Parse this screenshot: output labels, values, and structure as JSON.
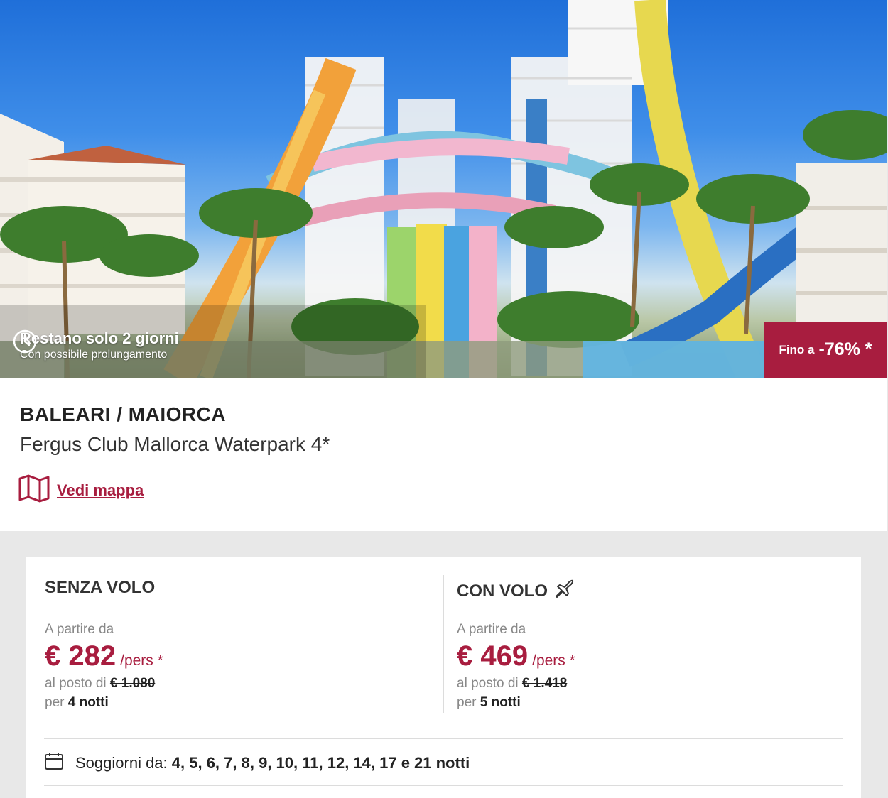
{
  "hero": {
    "timer_title": "Restano solo 2 giorni",
    "timer_subtitle": "Con possibile prolungamento",
    "discount_prefix": "Fino a",
    "discount_value": "-76% *",
    "image_subject": "waterpark slides"
  },
  "offer": {
    "region": "BALEARI / MAIORCA",
    "hotel_name": "Fergus Club Mallorca Waterpark 4*",
    "map_link": "Vedi mappa"
  },
  "pricing": {
    "without_flight": {
      "title": "SENZA VOLO",
      "from_label": "A partire da",
      "price": "€ 282",
      "per_label": "/pers *",
      "instead_label": "al posto di",
      "old_price": "€ 1.080",
      "nights_prefix": "per",
      "nights_value": "4 notti"
    },
    "with_flight": {
      "title": "CON VOLO",
      "from_label": "A partire da",
      "price": "€ 469",
      "per_label": "/pers *",
      "instead_label": "al posto di",
      "old_price": "€ 1.418",
      "nights_prefix": "per",
      "nights_value": "5 notti"
    },
    "stays_label": "Soggiorni da:",
    "stays_values": "4, 5, 6, 7, 8, 9, 10, 11, 12, 14, 17 e 21 notti"
  },
  "colors": {
    "accent": "#a81d3f",
    "background": "#e8e8e8"
  },
  "icons": [
    "clock-icon",
    "map-icon",
    "plane-icon",
    "calendar-icon"
  ]
}
